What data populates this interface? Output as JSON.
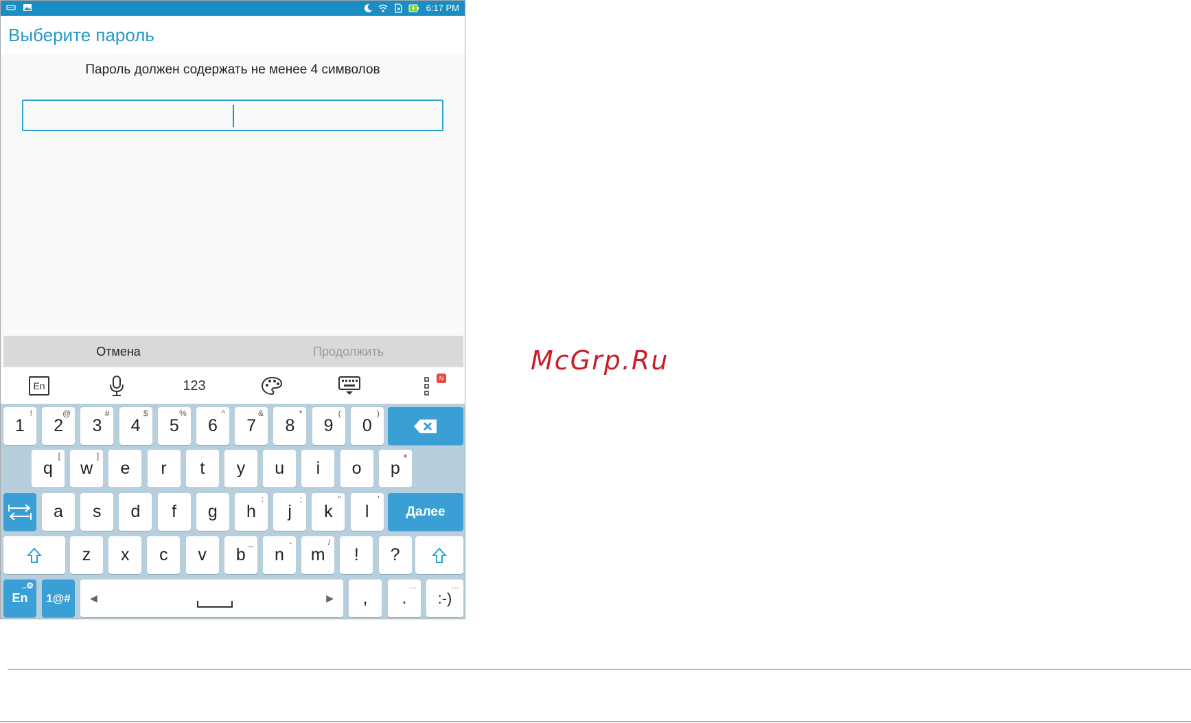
{
  "statusbar": {
    "time": "6:17 PM"
  },
  "screen": {
    "title": "Выберите пароль",
    "hint": "Пароль должен содержать не менее 4 символов",
    "password_value": ""
  },
  "buttons": {
    "cancel": "Отмена",
    "continue": "Продолжить"
  },
  "kb_toolbar": {
    "lang_icon_label": "En",
    "numbers_label": "123",
    "badge": "N"
  },
  "keyboard": {
    "row1": [
      {
        "k": "1",
        "s": "!"
      },
      {
        "k": "2",
        "s": "@"
      },
      {
        "k": "3",
        "s": "#"
      },
      {
        "k": "4",
        "s": "$"
      },
      {
        "k": "5",
        "s": "%"
      },
      {
        "k": "6",
        "s": "^"
      },
      {
        "k": "7",
        "s": "&"
      },
      {
        "k": "8",
        "s": "*"
      },
      {
        "k": "9",
        "s": "("
      },
      {
        "k": "0",
        "s": ")"
      }
    ],
    "row2": [
      {
        "k": "q",
        "s": "["
      },
      {
        "k": "w",
        "s": "]"
      },
      {
        "k": "e",
        "s": ""
      },
      {
        "k": "r",
        "s": ""
      },
      {
        "k": "t",
        "s": ""
      },
      {
        "k": "y",
        "s": ""
      },
      {
        "k": "u",
        "s": ""
      },
      {
        "k": "i",
        "s": ""
      },
      {
        "k": "o",
        "s": ""
      },
      {
        "k": "p",
        "s": "+"
      }
    ],
    "row3": [
      {
        "k": "a",
        "s": ""
      },
      {
        "k": "s",
        "s": ""
      },
      {
        "k": "d",
        "s": ""
      },
      {
        "k": "f",
        "s": ""
      },
      {
        "k": "g",
        "s": ""
      },
      {
        "k": "h",
        "s": ":"
      },
      {
        "k": "j",
        "s": ";"
      },
      {
        "k": "k",
        "s": "\""
      },
      {
        "k": "l",
        "s": "'"
      }
    ],
    "row4": [
      {
        "k": "z",
        "s": ""
      },
      {
        "k": "x",
        "s": ""
      },
      {
        "k": "c",
        "s": ""
      },
      {
        "k": "v",
        "s": ""
      },
      {
        "k": "b",
        "s": "_"
      },
      {
        "k": "n",
        "s": "-"
      },
      {
        "k": "m",
        "s": "/"
      },
      {
        "k": "!",
        "s": ""
      },
      {
        "k": "?",
        "s": ""
      }
    ],
    "enter_label": "Далее",
    "lang_key": "En",
    "symbols_key": "1@#",
    "comma": ",",
    "period": ".",
    "smiley": ":-)"
  },
  "watermark": "McGrp.Ru",
  "colors": {
    "accent": "#2797c6",
    "key_blue": "#3a9fd5",
    "keyboard_bg": "#b7cedd"
  }
}
